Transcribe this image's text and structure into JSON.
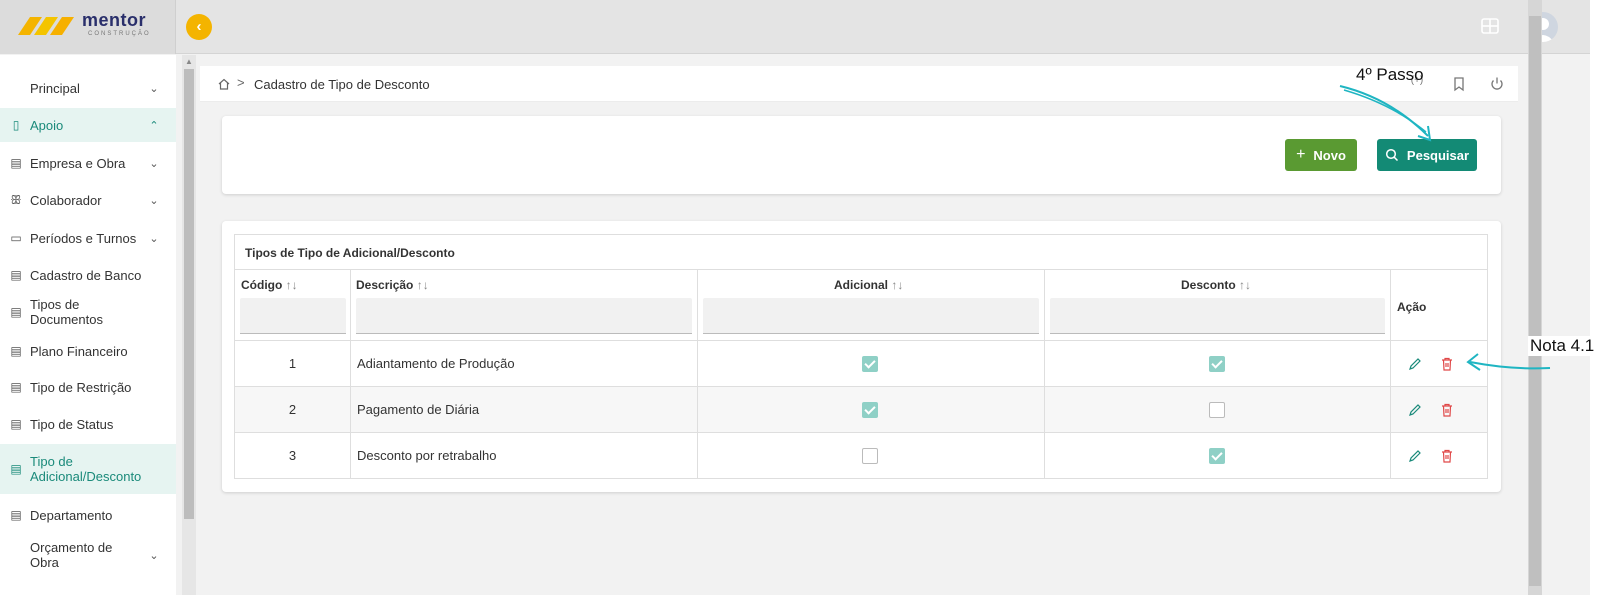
{
  "brand": {
    "name": "mentor",
    "tagline": "CONSTRUÇÃO"
  },
  "icons": {
    "collapse": "chevron-left-icon",
    "grid": "grid-icon",
    "avatar": "user-avatar",
    "home": "home-icon",
    "edit": "pencil-icon",
    "delete": "trash-icon"
  },
  "colors": {
    "accent": "#1a8a7a",
    "novo": "#5a9a32",
    "pesquisar": "#138a75",
    "collapse": "#f4b400",
    "delete": "#e04848"
  },
  "sidebar": {
    "items": [
      {
        "label": "Principal",
        "icon": "",
        "chevron": "down",
        "active": false
      },
      {
        "label": "Apoio",
        "icon": "box-icon",
        "chevron": "up",
        "active": true
      },
      {
        "label": "Empresa e Obra",
        "icon": "building-icon",
        "chevron": "down",
        "active": false
      },
      {
        "label": "Colaborador",
        "icon": "users-icon",
        "chevron": "down",
        "active": false
      },
      {
        "label": "Períodos e Turnos",
        "icon": "calendar-icon",
        "chevron": "down",
        "active": false
      },
      {
        "label": "Cadastro de Banco",
        "icon": "list-icon",
        "chevron": "",
        "active": false
      },
      {
        "label": "Tipos de Documentos",
        "icon": "list-icon",
        "chevron": "",
        "active": false
      },
      {
        "label": "Plano Financeiro",
        "icon": "list-icon",
        "chevron": "",
        "active": false
      },
      {
        "label": "Tipo de Restrição",
        "icon": "list-icon",
        "chevron": "",
        "active": false
      },
      {
        "label": "Tipo de Status",
        "icon": "list-icon",
        "chevron": "",
        "active": false
      },
      {
        "label": "Tipo de Adicional/Desconto",
        "icon": "list-icon",
        "chevron": "",
        "active": true
      },
      {
        "label": "Departamento",
        "icon": "list-icon",
        "chevron": "",
        "active": false
      },
      {
        "label": "Orçamento de Obra",
        "icon": "",
        "chevron": "down",
        "active": false
      }
    ]
  },
  "breadcrumb": {
    "separator": ">",
    "current": "Cadastro de Tipo de Desconto"
  },
  "toolbar": {
    "novo_label": "Novo",
    "pesquisar_label": "Pesquisar"
  },
  "table": {
    "title": "Tipos de Tipo de Adicional/Desconto",
    "columns": {
      "codigo": "Código",
      "descricao": "Descrição",
      "adicional": "Adicional",
      "desconto": "Desconto",
      "acao": "Ação"
    },
    "sort_glyph": "↑↓",
    "rows": [
      {
        "codigo": "1",
        "descricao": "Adiantamento de Produção",
        "adicional": true,
        "desconto": true
      },
      {
        "codigo": "2",
        "descricao": "Pagamento de Diária",
        "adicional": true,
        "desconto": false
      },
      {
        "codigo": "3",
        "descricao": "Desconto por retrabalho",
        "adicional": false,
        "desconto": true
      }
    ]
  },
  "annotations": {
    "step": "4º Passo",
    "note": "Nota 4.1"
  }
}
